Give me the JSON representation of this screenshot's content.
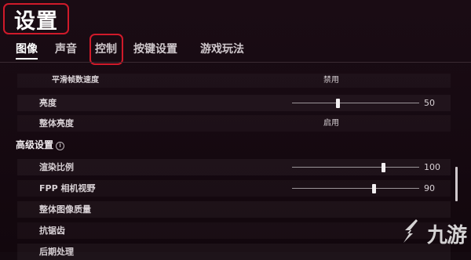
{
  "title": "设置",
  "tabs": [
    "图像",
    "声音",
    "控制",
    "按键设置",
    "游戏玩法"
  ],
  "active_tab": "图像",
  "highlighted_tab": "控制",
  "section_title": "高级设置",
  "settings": [
    {
      "label": "平滑帧数速度",
      "value": "禁用"
    },
    {
      "label": "亮度",
      "slider": 50,
      "value": "50"
    },
    {
      "label": "整体亮度",
      "value": "启用"
    },
    {
      "label": "渲染比例",
      "slider": 100,
      "value": "100"
    },
    {
      "label": "FPP 相机视野",
      "slider": 90,
      "value": "90"
    },
    {
      "label": "整体图像质量",
      "value": ""
    },
    {
      "label": "抗锯齿",
      "value": ""
    },
    {
      "label": "后期处理",
      "value": ""
    }
  ],
  "watermark": "九游",
  "colors": {
    "highlight": "#d01a2a",
    "background": "#140a10"
  }
}
